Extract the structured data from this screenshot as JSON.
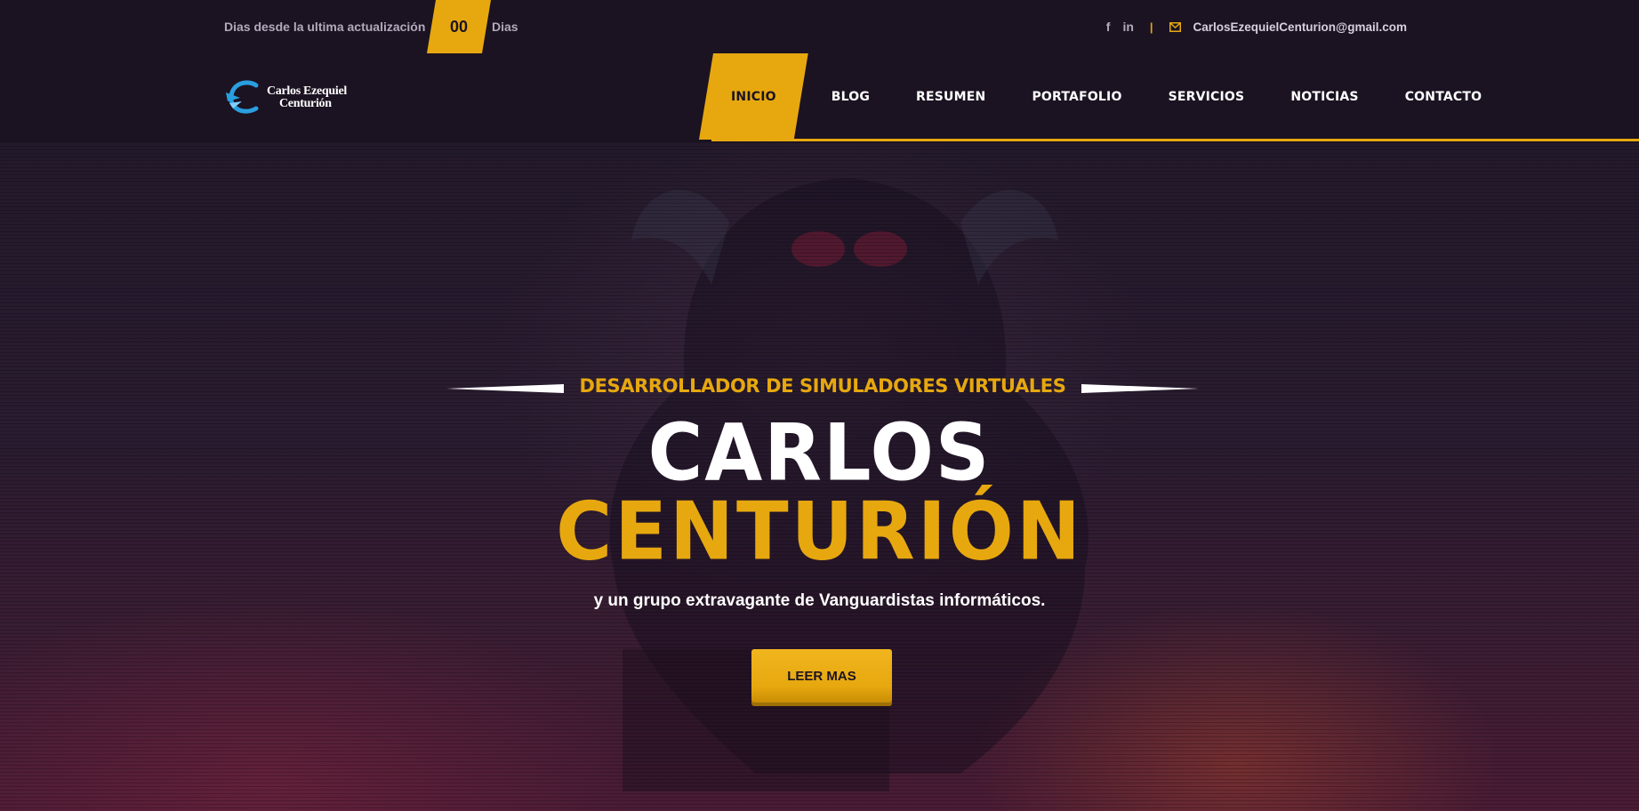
{
  "topbar": {
    "update_label": "Dias desde la ultima actualización",
    "days_count": "00",
    "days_unit": "Dias",
    "social": {
      "facebook": "f",
      "linkedin": "in"
    },
    "separator": "|",
    "email": "CarlosEzequielCenturion@gmail.com"
  },
  "logo": {
    "line1": "Carlos Ezequiel",
    "line2": "Centurión"
  },
  "nav": {
    "items": [
      "INICIO",
      "BLOG",
      "RESUMEN",
      "PORTAFOLIO",
      "SERVICIOS",
      "NOTICIAS",
      "CONTACTO"
    ],
    "active_index": 0
  },
  "hero": {
    "subtitle": "DESARROLLADOR DE SIMULADORES VIRTUALES",
    "name_first": "CARLOS",
    "name_last": "CENTURIÓN",
    "tagline": "y un grupo extravagante de Vanguardistas informáticos.",
    "cta_label": "LEER MAS"
  },
  "colors": {
    "accent": "#e7a80f",
    "background": "#1a1221",
    "logo_blue": "#2a9fe0"
  },
  "icons": {
    "facebook": "facebook-icon",
    "linkedin": "linkedin-icon",
    "mail": "envelope-icon",
    "logo": "logo-c-mark-icon"
  }
}
